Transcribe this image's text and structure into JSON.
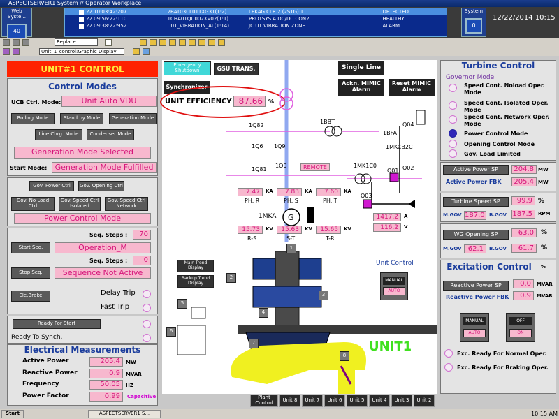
{
  "window": {
    "title": "ASPECTSERVER1 System // Operator Workplace",
    "left_tile": "Web Syste...",
    "left_count": "40",
    "right_tile": "System",
    "right_count": "0",
    "date": "12/22/2014 10:15"
  },
  "alarms": [
    {
      "time": "22 10:03:42:207",
      "tag": "2BAT03CL011XG31(1:2)",
      "desc": "LEKAG CLR 2 (2STG) T",
      "status": "DETECTED"
    },
    {
      "time": "22 09:56:22:110",
      "tag": "1CHA01QU002XV02(1:1)",
      "desc": "PROTSYS A DC/DC CON2",
      "status": "HEALTHY"
    },
    {
      "time": "22 09:38:22:952",
      "tag": "U01_VIBRATION_AL(1:14)",
      "desc": "JC U1 VIBRATION ZONE",
      "status": "ALARM"
    }
  ],
  "toolbar": {
    "replace": "Replace",
    "display": "Unit_1_control:Graphic Display"
  },
  "left": {
    "title": "UNIT#1 CONTROL",
    "modes_title": "Control Modes",
    "ucb_label": "UCB Ctrl. Mode:",
    "ucb_value": "Unit Auto VDU",
    "mode_buttons": [
      "Rolling Mode",
      "Stand by Mode",
      "Generation Mode",
      "Line Chrg. Mode",
      "Condenser Mode"
    ],
    "mode_selected": "Generation Mode Selected",
    "start_mode_label": "Start  Mode:",
    "start_mode_value": "Generation Mode Fulfilled",
    "gov_buttons": [
      "Gov. Power Ctrl",
      "Gov. Opening Ctrl",
      "Gov. No Load Ctrl",
      "Gov. Speed Ctrl Isolated",
      "Gov. Speed Ctrl Network"
    ],
    "power_mode": "Power Control Mode",
    "seq_steps_label": "Seq. Steps :",
    "seq_steps_1": "70",
    "start_seq": "Start Seq.",
    "start_seq_value": "Operation_M",
    "seq_steps_2": "0",
    "stop_seq": "Stop Seq.",
    "stop_seq_value": "Sequence Not Active",
    "ele_brake": "Ele.Brake",
    "delay_trip": "Delay  Trip",
    "fast_trip": "Fast  Trip",
    "ready_start": "Ready For Start",
    "ready_synch": "Ready To Synch.",
    "elec_title": "Electrical Measurements",
    "measurements": [
      {
        "label": "Active Power",
        "value": "205.4",
        "unit": "MW"
      },
      {
        "label": "Reactive Power",
        "value": "0.9",
        "unit": "MVAR"
      },
      {
        "label": "Frequency",
        "value": "50.05",
        "unit": "HZ"
      },
      {
        "label": "Power Factor",
        "value": "0.99",
        "unit": "Capacitive"
      }
    ]
  },
  "center": {
    "emergency": "Emergency Shutdown",
    "gsu": "GSU TRANS.",
    "single_line": "Single Line",
    "synchronizer": "Synchronizer",
    "ack": "Ackn. MIMIC Alarm",
    "reset": "Reset MIMIC Alarm",
    "eff_label": "UNIT EFFICIENCY",
    "eff_value": "87.66",
    "eff_unit": "%",
    "labels": {
      "q82": "1Q82",
      "q6": "1Q6",
      "q9": "1Q9",
      "q81": "1Q81",
      "q0": "1Q0",
      "bbt": "1BBT",
      "bfa": "1BFA",
      "q04": "Q04",
      "mkcb": "1MKCB2C",
      "mk1": "1MK1C0",
      "q01": "Q01",
      "q02": "Q02",
      "q03": "Q03",
      "mka": "1MKA",
      "g": "G",
      "remote": "REMOTE"
    },
    "currents": [
      {
        "v": "7.47",
        "u": "KA",
        "ph": "PH. R"
      },
      {
        "v": "7.83",
        "u": "KA",
        "ph": "PH. S"
      },
      {
        "v": "7.60",
        "u": "KA",
        "ph": "PH. T"
      }
    ],
    "voltages": [
      {
        "v": "15.73",
        "u": "KV",
        "ph": "R-S"
      },
      {
        "v": "15.63",
        "u": "KV",
        "ph": "S-T"
      },
      {
        "v": "15.65",
        "u": "KV",
        "ph": "T-R"
      }
    ],
    "field_a": "1417.2",
    "field_a_u": "A",
    "field_v": "116.2",
    "field_v_u": "V",
    "main_trend": "Main Trend Display",
    "backup_trend": "Backup Trend Display",
    "nums": [
      "1",
      "2",
      "3",
      "4",
      "5",
      "6",
      "7",
      "8"
    ],
    "unit_control": "Unit Control",
    "manual": "MANUAL",
    "auto": "AUTO",
    "unit_label": "UNIT1"
  },
  "tabs": [
    "Plant Control",
    "Unit 8",
    "Unit 7",
    "Unit 6",
    "Unit 5",
    "Unit 4",
    "Unit 3",
    "Unit 2"
  ],
  "right": {
    "title": "Turbine Control",
    "gov_mode": "Governor Mode",
    "gov_options": [
      "Speed Cont. Noload Oper. Mode",
      "Speed Cont. Isolated Oper. Mode",
      "Speed Cont. Network Oper. Mode",
      "Power Control Mode",
      "Opening Control Mode",
      "Gov. Load Limited"
    ],
    "active_sp": "Active Power SP",
    "active_sp_v": "204.8",
    "active_fbk": "Active Power FBK",
    "active_fbk_v": "205.4",
    "mw": "MW",
    "speed_sp": "Turbine Speed SP",
    "speed_sp_v": "99.9",
    "pct": "%",
    "mgov": "M.GOV",
    "mgov_v": "187.0",
    "bgov": "B.GOV",
    "bgov_v": "187.5",
    "rpm": "RPM",
    "wg_sp": "WG Opening SP",
    "wg_sp_v": "63.0",
    "mgov2_v": "62.1",
    "bgov2_v": "61.7",
    "exc_title": "Excitation Control",
    "exc_pct": "%",
    "react_sp": "Reactive Power SP",
    "react_sp_v": "0.0",
    "react_fbk": "Reactive Power FBK",
    "react_fbk_v": "0.9",
    "mvar": "MVAR",
    "manual": "MANUAL",
    "auto": "AUTO",
    "off": "OFF",
    "on": "ON",
    "exc_normal": "Exc. Ready For Normal Oper.",
    "exc_braking": "Exc. Ready For Braking  Oper."
  },
  "taskbar": {
    "start": "Start",
    "item": "ASPECTSERVER1 S...",
    "time": "10:15 AM"
  }
}
